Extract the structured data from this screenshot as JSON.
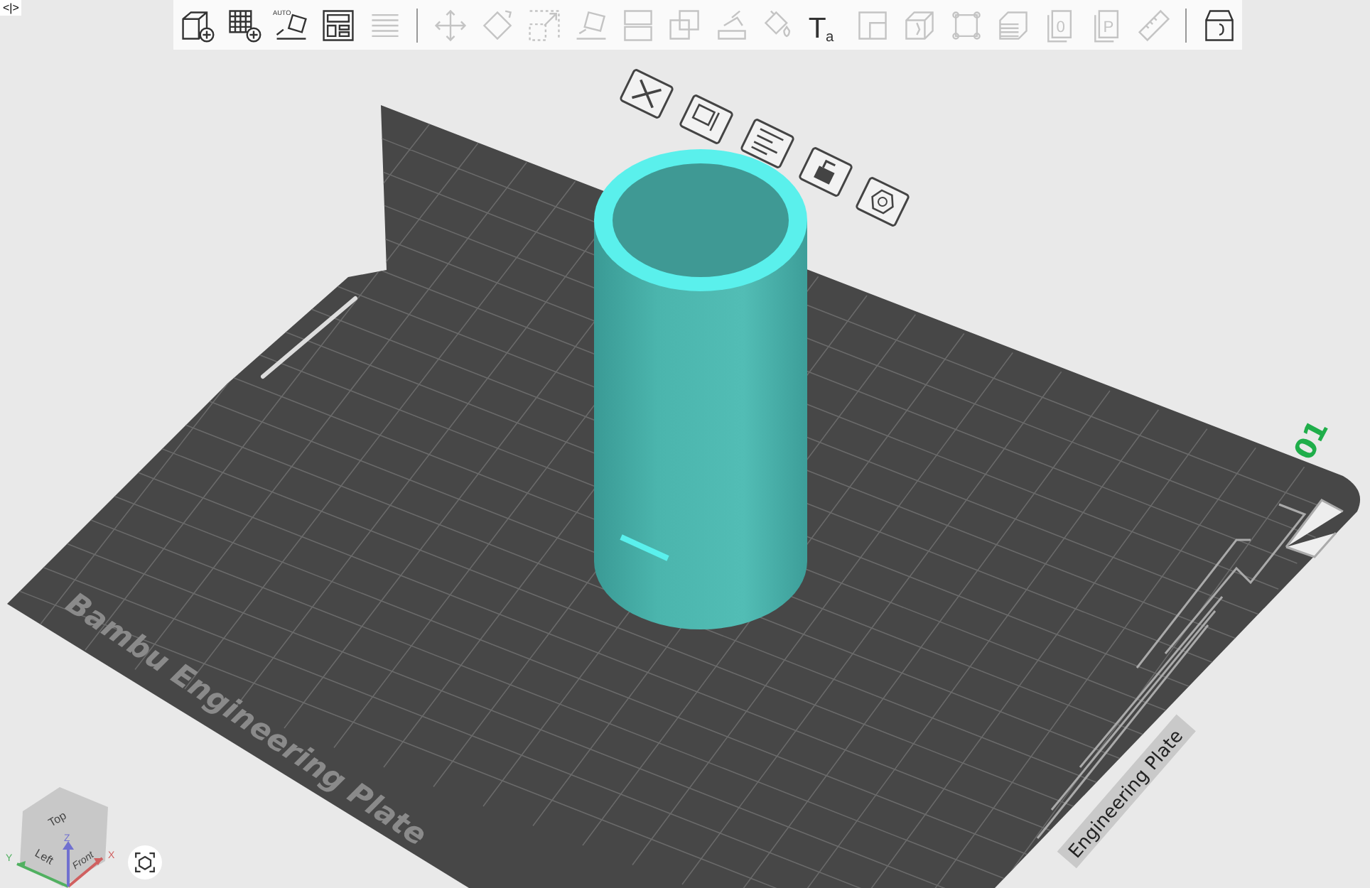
{
  "corner_tag": "<|>",
  "toolbar": [
    {
      "kind": "add-object",
      "disabled": false
    },
    {
      "kind": "add-plate",
      "disabled": false
    },
    {
      "kind": "auto-arrange",
      "disabled": false,
      "glyph": "AUTO"
    },
    {
      "kind": "plate-layout",
      "disabled": false
    },
    {
      "kind": "layers",
      "disabled": true
    },
    {
      "kind": "separator"
    },
    {
      "kind": "move",
      "disabled": true
    },
    {
      "kind": "rotate",
      "disabled": true
    },
    {
      "kind": "scale",
      "disabled": true
    },
    {
      "kind": "lay-on-face",
      "disabled": true
    },
    {
      "kind": "split",
      "disabled": true
    },
    {
      "kind": "boolean",
      "disabled": true
    },
    {
      "kind": "support-paint",
      "disabled": true
    },
    {
      "kind": "color-paint",
      "disabled": true
    },
    {
      "kind": "text",
      "disabled": false,
      "glyph": "Ta"
    },
    {
      "kind": "seam",
      "disabled": true
    },
    {
      "kind": "mesh",
      "disabled": true
    },
    {
      "kind": "frame",
      "disabled": true
    },
    {
      "kind": "stack",
      "disabled": true
    },
    {
      "kind": "page",
      "disabled": true,
      "glyph": "0"
    },
    {
      "kind": "page",
      "disabled": true,
      "glyph": "P"
    },
    {
      "kind": "ruler",
      "disabled": true
    },
    {
      "kind": "separator"
    },
    {
      "kind": "assembly",
      "disabled": false
    }
  ],
  "plate": {
    "name": "Bambu Engineering Plate",
    "number": "01",
    "corner_label": "Engineering Plate",
    "tools": [
      {
        "kind": "close"
      },
      {
        "kind": "edit"
      },
      {
        "kind": "arrange"
      },
      {
        "kind": "lock"
      },
      {
        "kind": "settings"
      }
    ]
  },
  "view_cube": {
    "faces": [
      "Top",
      "Left",
      "Front"
    ],
    "axes": [
      "X",
      "Y",
      "Z"
    ]
  }
}
